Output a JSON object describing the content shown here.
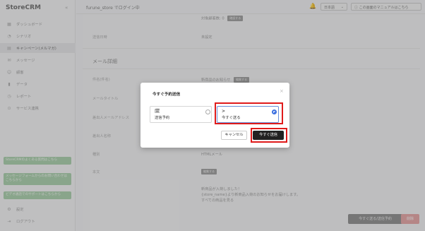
{
  "app": {
    "logo": "StoreCRM",
    "collapse_icon": "«"
  },
  "sidebar": {
    "items": [
      {
        "icon": "dashboard-icon",
        "glyph": "▦",
        "label": "ダッシュボード"
      },
      {
        "icon": "scenario-icon",
        "glyph": "◔",
        "label": "シナリオ"
      },
      {
        "icon": "campaign-icon",
        "glyph": "▤",
        "label": "キャンペーン(メルマガ)"
      },
      {
        "icon": "message-icon",
        "glyph": "✉",
        "label": "メッセージ"
      },
      {
        "icon": "customer-icon",
        "glyph": "☺",
        "label": "顧客"
      },
      {
        "icon": "data-icon",
        "glyph": "▮",
        "label": "データ"
      },
      {
        "icon": "report-icon",
        "glyph": "◷",
        "label": "レポート"
      },
      {
        "icon": "service-icon",
        "glyph": "⊙",
        "label": "サービス連携"
      }
    ],
    "help_buttons": [
      "StoreCRMのよくある質問はこちら",
      "メッセージフォームからのお問い合わせはこちらから",
      "ビデオ通話でのサポートはこちらから"
    ],
    "bottom_items": [
      {
        "icon": "settings-icon",
        "glyph": "⚙",
        "label": "設定"
      },
      {
        "icon": "logout-icon",
        "glyph": "⇥",
        "label": "ログアウト"
      }
    ]
  },
  "header": {
    "login_text": "furune_store でログイン中",
    "language": "日本語",
    "manual_button": "この画面のマニュアルはこちら"
  },
  "main": {
    "top_value": "対象顧客数: 0",
    "top_pill": "確認する",
    "rows_top": [
      {
        "label": "送信日時",
        "value": "未設定"
      }
    ],
    "section_title": "メール詳細",
    "rows": [
      {
        "label": "件名(件名)",
        "value": "新商品のお知らせ",
        "pill": "編集する"
      },
      {
        "label": "メールタイトル",
        "value": ""
      },
      {
        "label": "差出人メールアドレス",
        "value": ""
      },
      {
        "label": "差出人名称",
        "value": ""
      },
      {
        "label": "種別",
        "value": "HTMLメール"
      },
      {
        "label": "本文",
        "value": "",
        "pill": "編集する"
      }
    ],
    "body_lines": [
      "新商品が入荷しました！",
      "{store_name}より新商品入荷のお知らせをお届けします。",
      "すべての商品を見る"
    ],
    "reserve_button": "今すぐ送る/送信予約",
    "delete_button": "削除"
  },
  "modal": {
    "title": "今すぐ予約送信",
    "close": "×",
    "option_schedule": {
      "icon": "calendar-icon",
      "glyph": "🗓",
      "label": "送信予約"
    },
    "option_now": {
      "icon": "send-icon",
      "glyph": ">",
      "label": "今すぐ送る"
    },
    "selected": "今すぐ送る",
    "cancel_button": "キャンセル",
    "send_button": "今すぐ送信"
  },
  "colors": {
    "highlight": "#e01b1b",
    "help_button": "#a6cfa9",
    "primary_dark": "#222222",
    "radio_selected": "#3b6fe0"
  }
}
